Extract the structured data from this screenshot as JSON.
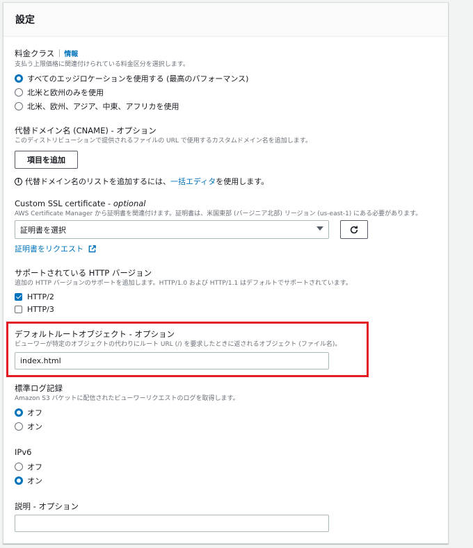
{
  "panel": {
    "title": "設定"
  },
  "price_class": {
    "label": "料金クラス",
    "info": "情報",
    "description": "支払う上限価格に関連付けられている料金区分を選択します。",
    "options": [
      {
        "label": "すべてのエッジロケーションを使用する (最高のパフォーマンス)",
        "checked": true
      },
      {
        "label": "北米と欧州のみを使用",
        "checked": false
      },
      {
        "label": "北米、欧州、アジア、中東、アフリカを使用",
        "checked": false
      }
    ]
  },
  "cname": {
    "label": "代替ドメイン名 (CNAME) - オプション",
    "description": "このディストリビューションで提供されるファイルの URL で使用するカスタムドメイン名を追加します。",
    "add_button": "項目を追加",
    "info_text_before": "代替ドメイン名のリストを追加するには、",
    "info_link": "一括エディタ",
    "info_text_after": " を使用します。"
  },
  "ssl": {
    "label": "Custom SSL certificate - ",
    "label_optional": "optional",
    "description": "AWS Certificate Manager から証明書を関連付けます。証明書は、米国東部 (バージニア北部) リージョン (us-east-1) にある必要があります。",
    "select_placeholder": "証明書を選択",
    "request_link": "証明書をリクエスト"
  },
  "http_version": {
    "label": "サポートされている HTTP バージョン",
    "description": "追加の HTTP バージョンのサポートを追加します。HTTP/1.0 および HTTP/1.1 はデフォルトでサポートされています。",
    "options": [
      {
        "label": "HTTP/2",
        "checked": true
      },
      {
        "label": "HTTP/3",
        "checked": false
      }
    ]
  },
  "default_root": {
    "label": "デフォルトルートオブジェクト - オプション",
    "description": "ビューワーが特定のオブジェクトの代わりにルート URL (/) を要求したときに返されるオブジェクト (ファイル名)。",
    "value": "index.html"
  },
  "logging": {
    "label": "標準ログ記録",
    "description": "Amazon S3 バケットに配信されたビューワーリクエストのログを取得します。",
    "options": [
      {
        "label": "オフ",
        "checked": true
      },
      {
        "label": "オン",
        "checked": false
      }
    ]
  },
  "ipv6": {
    "label": "IPv6",
    "options": [
      {
        "label": "オフ",
        "checked": false
      },
      {
        "label": "オン",
        "checked": true
      }
    ]
  },
  "description_field": {
    "label": "説明 - オプション",
    "value": ""
  },
  "colors": {
    "accent": "#0073bb",
    "highlight": "#e31b23"
  },
  "icons": {
    "refresh": "refresh-icon",
    "external": "external-link-icon",
    "info": "info-circle-icon",
    "caret": "caret-down-icon"
  }
}
